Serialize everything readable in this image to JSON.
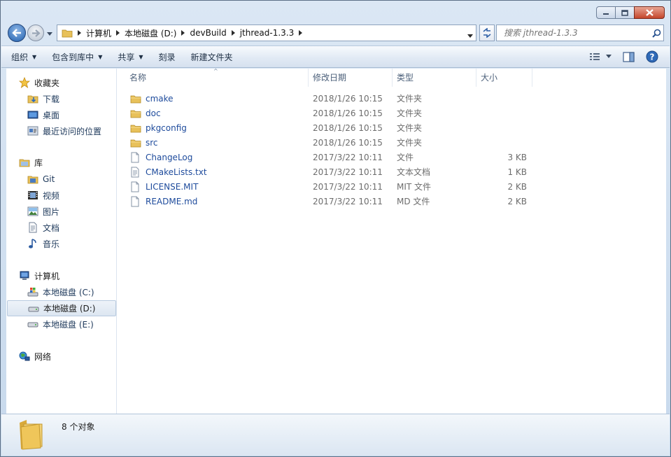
{
  "window": {
    "caption_buttons": [
      "minimize-icon",
      "maximize-icon",
      "close-icon"
    ]
  },
  "address": {
    "crumbs": [
      "计算机",
      "本地磁盘 (D:)",
      "devBuild",
      "jthread-1.3.3"
    ]
  },
  "search": {
    "placeholder": "搜索 jthread-1.3.3"
  },
  "toolbar": {
    "organize": "组织",
    "include_in_library": "包含到库中",
    "share": "共享",
    "burn": "刻录",
    "new_folder": "新建文件夹"
  },
  "nav": {
    "favorites": {
      "label": "收藏夹",
      "items": [
        "下载",
        "桌面",
        "最近访问的位置"
      ]
    },
    "libraries": {
      "label": "库",
      "items": [
        "Git",
        "视频",
        "图片",
        "文档",
        "音乐"
      ]
    },
    "computer": {
      "label": "计算机",
      "items": [
        "本地磁盘 (C:)",
        "本地磁盘 (D:)",
        "本地磁盘 (E:)"
      ]
    },
    "network": {
      "label": "网络"
    }
  },
  "columns": {
    "name": "名称",
    "modified": "修改日期",
    "type": "类型",
    "size": "大小"
  },
  "files": [
    {
      "name": "cmake",
      "date": "2018/1/26 10:15",
      "type": "文件夹",
      "size": "",
      "kind": "folder"
    },
    {
      "name": "doc",
      "date": "2018/1/26 10:15",
      "type": "文件夹",
      "size": "",
      "kind": "folder"
    },
    {
      "name": "pkgconfig",
      "date": "2018/1/26 10:15",
      "type": "文件夹",
      "size": "",
      "kind": "folder"
    },
    {
      "name": "src",
      "date": "2018/1/26 10:15",
      "type": "文件夹",
      "size": "",
      "kind": "folder"
    },
    {
      "name": "ChangeLog",
      "date": "2017/3/22 10:11",
      "type": "文件",
      "size": "3 KB",
      "kind": "file"
    },
    {
      "name": "CMakeLists.txt",
      "date": "2017/3/22 10:11",
      "type": "文本文档",
      "size": "1 KB",
      "kind": "text"
    },
    {
      "name": "LICENSE.MIT",
      "date": "2017/3/22 10:11",
      "type": "MIT 文件",
      "size": "2 KB",
      "kind": "file"
    },
    {
      "name": "README.md",
      "date": "2017/3/22 10:11",
      "type": "MD 文件",
      "size": "2 KB",
      "kind": "file"
    }
  ],
  "details": {
    "count": "8 个对象"
  },
  "colors": {
    "link": "#1e4b9c",
    "accent": "#1f5fae",
    "folder": "#e8c15a"
  }
}
